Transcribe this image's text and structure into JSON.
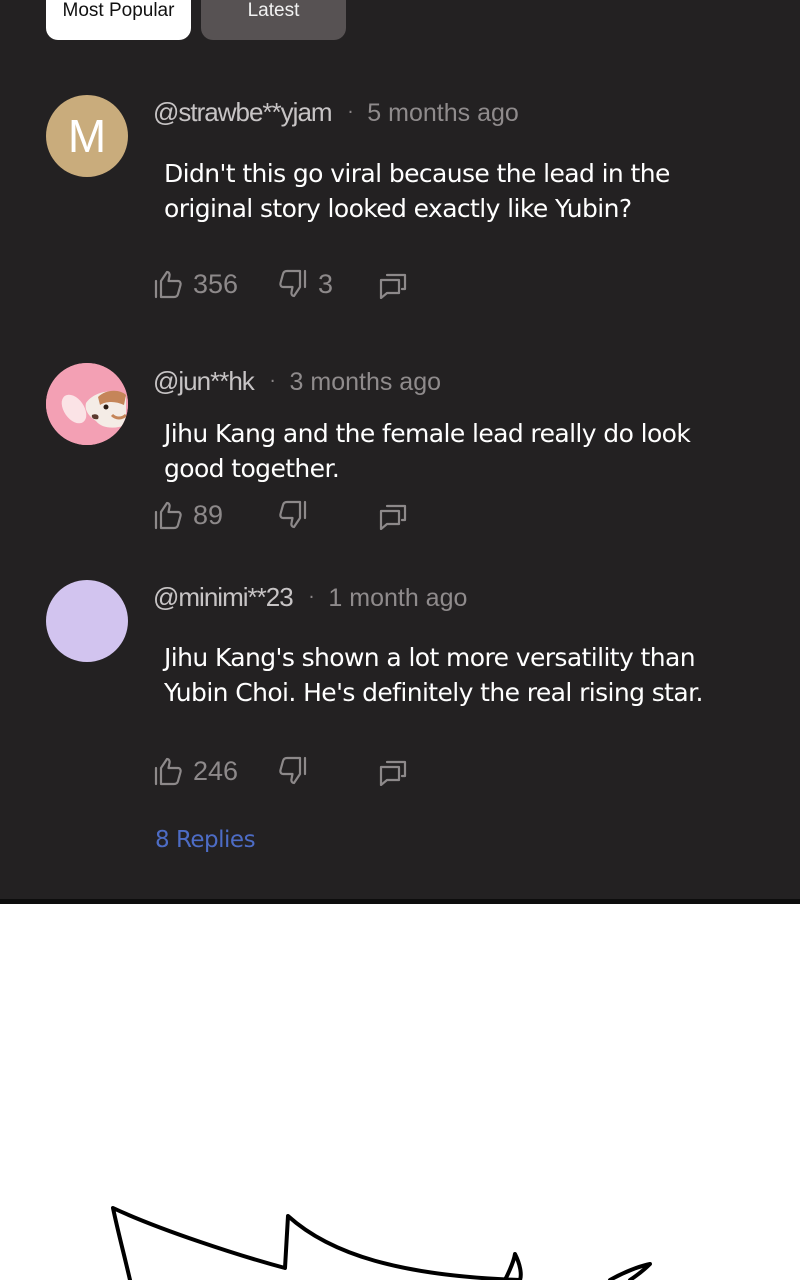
{
  "tabs": [
    {
      "label": "Most Popular",
      "active": true
    },
    {
      "label": "Latest",
      "active": false
    }
  ],
  "comments": [
    {
      "avatar": {
        "type": "letter",
        "letter": "M",
        "color": "#c9ac7c"
      },
      "username": "@strawbe**yjam",
      "time": "5 months ago",
      "text": "Didn't this go viral because the lead in the original story looked exactly like Yubin?",
      "likes": "356",
      "dislikes": "3"
    },
    {
      "avatar": {
        "type": "photo",
        "color": "#f3a0b4"
      },
      "username": "@jun**hk",
      "time": "3 months ago",
      "text": "Jihu Kang and the female lead really do look good together.",
      "likes": "89",
      "dislikes": ""
    },
    {
      "avatar": {
        "type": "plain",
        "color": "#d2c4ef"
      },
      "username": "@minimi**23",
      "time": "1 month ago",
      "text": "Jihu Kang's shown a lot more versatility than Yubin Choi. He's definitely the real rising star.",
      "likes": "246",
      "dislikes": ""
    }
  ],
  "replies_link": "8 Replies",
  "icons": {
    "like": "thumbs-up-icon",
    "dislike": "thumbs-down-icon",
    "reply": "reply-icon"
  },
  "colors": {
    "panel": "#232122",
    "link": "#4d6cc5",
    "active_tab": "#ffffff",
    "inactive_tab": "#575253"
  }
}
